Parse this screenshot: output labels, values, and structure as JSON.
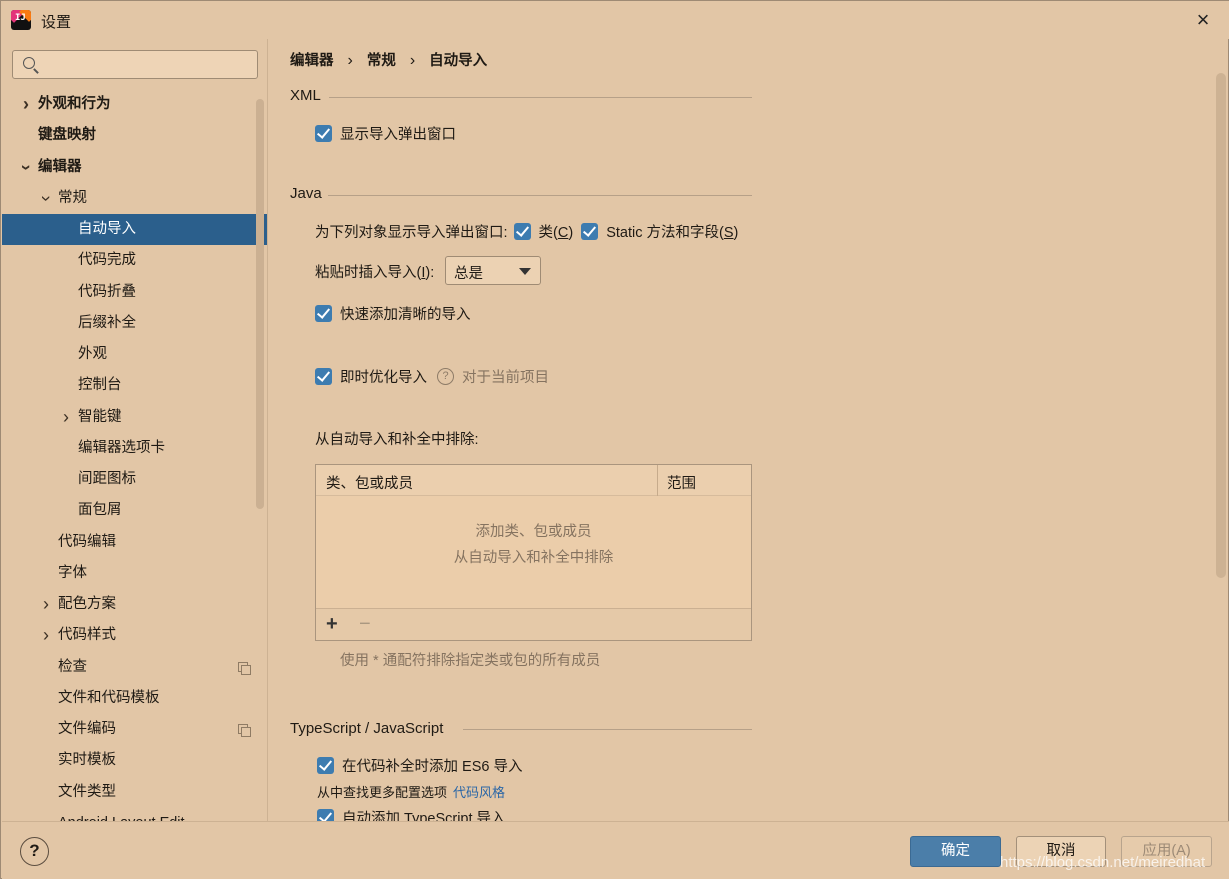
{
  "window": {
    "title": "设置",
    "close_icon": "×"
  },
  "search": {
    "placeholder": "",
    "value": ""
  },
  "sidebar": {
    "items": [
      {
        "label": "外观和行为"
      },
      {
        "label": "键盘映射"
      },
      {
        "label": "编辑器"
      },
      {
        "label": "常规"
      },
      {
        "label": "自动导入"
      },
      {
        "label": "代码完成"
      },
      {
        "label": "代码折叠"
      },
      {
        "label": "后缀补全"
      },
      {
        "label": "外观"
      },
      {
        "label": "控制台"
      },
      {
        "label": "智能键"
      },
      {
        "label": "编辑器选项卡"
      },
      {
        "label": "间距图标"
      },
      {
        "label": "面包屑"
      },
      {
        "label": "代码编辑"
      },
      {
        "label": "字体"
      },
      {
        "label": "配色方案"
      },
      {
        "label": "代码样式"
      },
      {
        "label": "检查"
      },
      {
        "label": "文件和代码模板"
      },
      {
        "label": "文件编码"
      },
      {
        "label": "实时模板"
      },
      {
        "label": "文件类型"
      },
      {
        "label": "Android Layout Edit"
      }
    ]
  },
  "breadcrumb": {
    "part1": "编辑器",
    "part2": "常规",
    "part3": "自动导入",
    "sep": "›"
  },
  "xml": {
    "title": "XML",
    "show_popup_label": "显示导入弹出窗口"
  },
  "java": {
    "title": "Java",
    "show_popup_for": "为下列对象显示导入弹出窗口:",
    "classes_label": "类(",
    "classes_mnemonic": "C",
    "static_label": "Static 方法和字段(",
    "static_mnemonic": "S",
    "paren_close": ")",
    "paste_label": "粘贴时插入导入(",
    "paste_mnemonic": "I",
    "paste_suffix": "):",
    "paste_value": "总是",
    "add_unambiguous": "快速添加清晰的导入",
    "optimize_on_fly": "即时优化导入",
    "optimize_help": "?",
    "optimize_note": "对于当前项目",
    "exclude_title": "从自动导入和补全中排除:",
    "table": {
      "col1": "类、包或成员",
      "col2": "范围",
      "empty_line1": "添加类、包或成员",
      "empty_line2": "从自动导入和补全中排除",
      "add": "+",
      "remove": "−"
    },
    "hint": "使用 * 通配符排除指定类或包的所有成员"
  },
  "ts": {
    "title": "TypeScript / JavaScript",
    "add_es6": "在代码补全时添加 ES6 导入",
    "more_options": "从中查找更多配置选项",
    "code_style_link": "代码风格",
    "auto_add_ts": "自动添加 TypeScript 导入"
  },
  "footer": {
    "help": "?",
    "ok": "确定",
    "cancel": "取消",
    "apply": "应用(A)",
    "watermark": "https://blog.csdn.net/meiredhat"
  },
  "colors": {
    "background": "#e2c6a6",
    "selection": "#2b5f8c",
    "checkbox": "#3d7cb0",
    "primary_button": "#4b7ea9",
    "link": "#2a66a6"
  }
}
